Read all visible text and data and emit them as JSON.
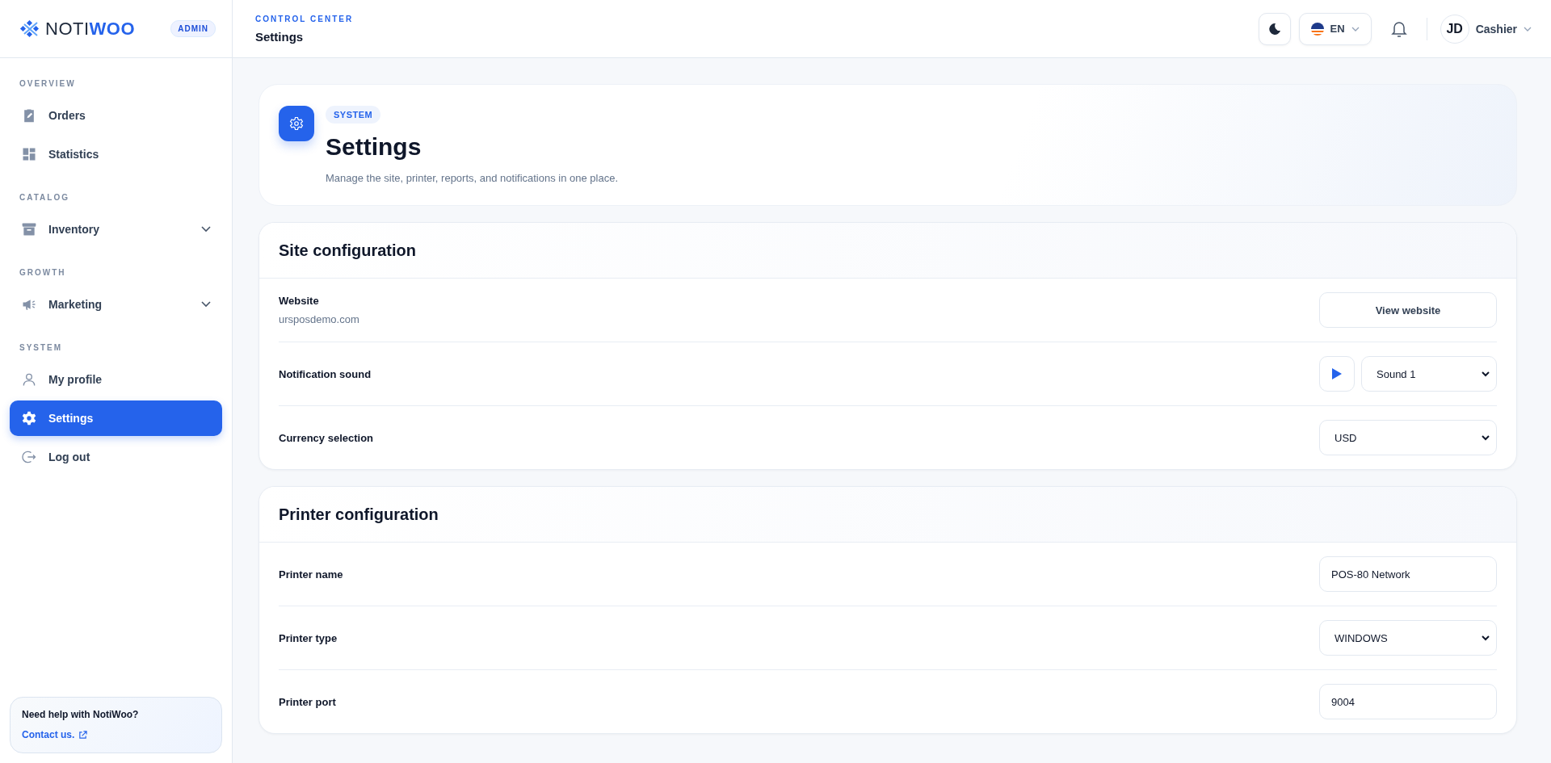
{
  "brand": {
    "name_light": "NOTI",
    "name_bold": "WOO",
    "badge": "ADMIN"
  },
  "sidebar": {
    "sections": [
      {
        "title": "OVERVIEW",
        "items": [
          {
            "label": "Orders",
            "kind": "clipboard",
            "expandable": false,
            "selected": false
          },
          {
            "label": "Statistics",
            "kind": "grid",
            "expandable": false,
            "selected": false
          }
        ]
      },
      {
        "title": "CATALOG",
        "items": [
          {
            "label": "Inventory",
            "kind": "archive",
            "expandable": true,
            "selected": false
          }
        ]
      },
      {
        "title": "GROWTH",
        "items": [
          {
            "label": "Marketing",
            "kind": "megaphone",
            "expandable": true,
            "selected": false
          }
        ]
      },
      {
        "title": "SYSTEM",
        "items": [
          {
            "label": "My profile",
            "kind": "user",
            "expandable": false,
            "selected": false
          },
          {
            "label": "Settings",
            "kind": "gear",
            "expandable": false,
            "selected": true
          },
          {
            "label": "Log out",
            "kind": "logout",
            "expandable": false,
            "selected": false
          }
        ]
      }
    ]
  },
  "help": {
    "text": "Need help with NotiWoo?",
    "link": "Contact us."
  },
  "header": {
    "eyebrow": "CONTROL CENTER",
    "title": "Settings",
    "language": "EN",
    "avatar": "JD",
    "user": "Cashier"
  },
  "hero": {
    "tag": "SYSTEM",
    "title": "Settings",
    "description": "Manage the site, printer, reports, and notifications in one place."
  },
  "sections": [
    {
      "title": "Site configuration",
      "rows": [
        {
          "label": "Website",
          "sublabel": "ursposdemo.com",
          "kind": "button",
          "value": "View website"
        },
        {
          "label": "Notification sound",
          "kind": "sound",
          "value": "Sound 1"
        },
        {
          "label": "Currency selection",
          "kind": "select",
          "value": "USD"
        }
      ]
    },
    {
      "title": "Printer configuration",
      "rows": [
        {
          "label": "Printer name",
          "kind": "input",
          "value": "POS-80 Network"
        },
        {
          "label": "Printer type",
          "kind": "select",
          "value": "WINDOWS"
        },
        {
          "label": "Printer port",
          "kind": "input",
          "value": "9004"
        }
      ]
    }
  ]
}
